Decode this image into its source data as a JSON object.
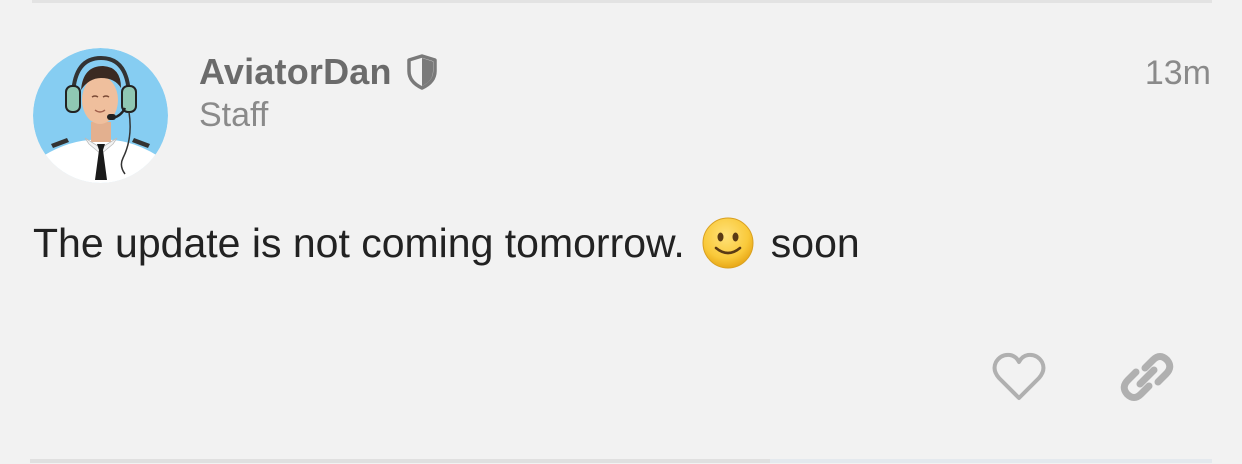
{
  "post": {
    "author": {
      "username": "AviatorDan",
      "role": "Staff",
      "badge_icon": "shield-icon",
      "avatar": "pilot-avatar"
    },
    "time": "13m",
    "body": {
      "text_before": "The update is not coming tomorrow.",
      "emoji": "slightly-smiling-face-emoji",
      "text_after": "soon"
    },
    "actions": {
      "like_icon": "heart-icon",
      "link_icon": "link-icon"
    }
  },
  "colors": {
    "background": "#f2f2f2",
    "username": "#6b6b6b",
    "muted": "#8a8a8a",
    "body_text": "#222222",
    "avatar_bg": "#86cdf2",
    "icon_gray": "#b0b0b0"
  }
}
